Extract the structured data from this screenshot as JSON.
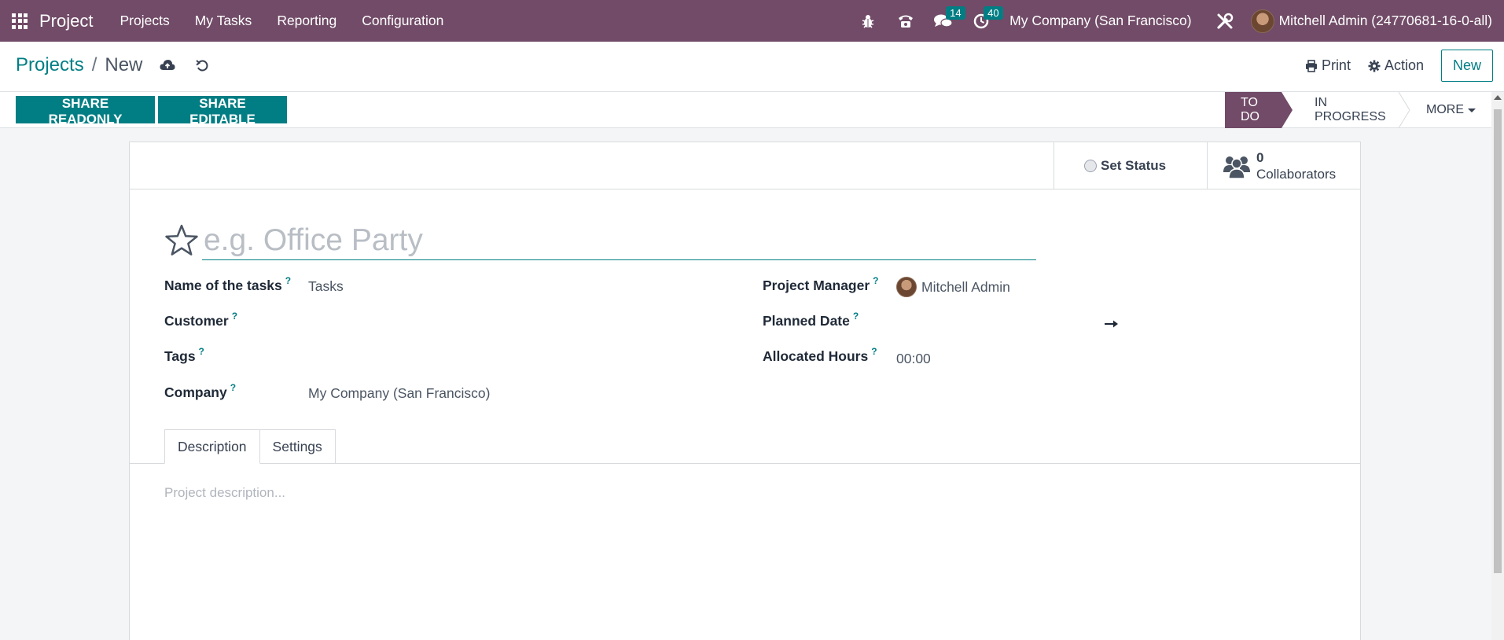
{
  "navbar": {
    "brand": "Project",
    "menu": [
      "Projects",
      "My Tasks",
      "Reporting",
      "Configuration"
    ],
    "messages_badge": "14",
    "activities_badge": "40",
    "company": "My Company (San Francisco)",
    "user": "Mitchell Admin (24770681-16-0-all)",
    "accent_color": "#714b67"
  },
  "breadcrumb": {
    "parent": "Projects",
    "separator": "/",
    "current": "New"
  },
  "control_panel": {
    "print_label": "Print",
    "action_label": "Action",
    "new_label": "New"
  },
  "statusbar": {
    "share_readonly": "SHARE READONLY",
    "share_editable": "SHARE EDITABLE",
    "stages": [
      "TO DO",
      "IN PROGRESS"
    ],
    "more_label": "MORE",
    "active_stage": "TO DO"
  },
  "button_box": {
    "set_status": "Set Status",
    "collaborators_count": "0",
    "collaborators_label": "Collaborators"
  },
  "form": {
    "title_placeholder": "e.g. Office Party",
    "help_mark": "?",
    "left_fields": [
      {
        "label": "Name of the tasks",
        "value": "Tasks"
      },
      {
        "label": "Customer",
        "value": ""
      },
      {
        "label": "Tags",
        "value": ""
      },
      {
        "label": "Company",
        "value": "My Company (San Francisco)"
      }
    ],
    "right_fields": [
      {
        "label": "Project Manager",
        "value": "Mitchell Admin"
      },
      {
        "label": "Planned Date",
        "value": ""
      },
      {
        "label": "Allocated Hours",
        "value": "00:00"
      }
    ],
    "tabs": [
      "Description",
      "Settings"
    ],
    "active_tab": "Description",
    "description_placeholder": "Project description..."
  }
}
